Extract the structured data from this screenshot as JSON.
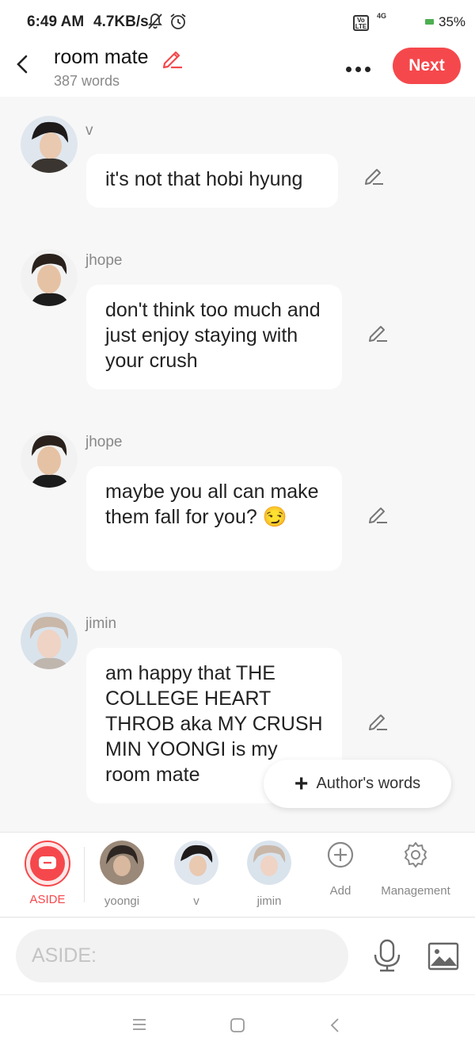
{
  "status_bar": {
    "time": "6:49 AM",
    "net_speed": "4.7KB/s",
    "network": "4G",
    "battery": "35%",
    "icons": [
      "bell-off-icon",
      "alarm-icon",
      "volte-icon",
      "signal-icon",
      "battery-icon"
    ]
  },
  "header": {
    "title": "room mate",
    "word_count": "387 words",
    "next_label": "Next"
  },
  "messages": [
    {
      "speaker": "v",
      "text": "it's not that hobi hyung"
    },
    {
      "speaker": "jhope",
      "text": "don't think too much and just enjoy staying with your crush"
    },
    {
      "speaker": "jhope",
      "text": "maybe you all can make them fall for you? 😏"
    },
    {
      "speaker": "jimin",
      "text": "am happy that THE COLLEGE HEART THROB aka MY CRUSH MIN YOONGI is my room mate"
    }
  ],
  "author_words_label": "Author's words",
  "characters": {
    "aside": "ASIDE",
    "yoongi": "yoongi",
    "v": "v",
    "jimin": "jimin",
    "add": "Add",
    "management": "Management"
  },
  "input": {
    "placeholder": "ASIDE:"
  },
  "colors": {
    "accent": "#f5484c",
    "background": "#f7f7f7",
    "bubble": "#ffffff"
  }
}
